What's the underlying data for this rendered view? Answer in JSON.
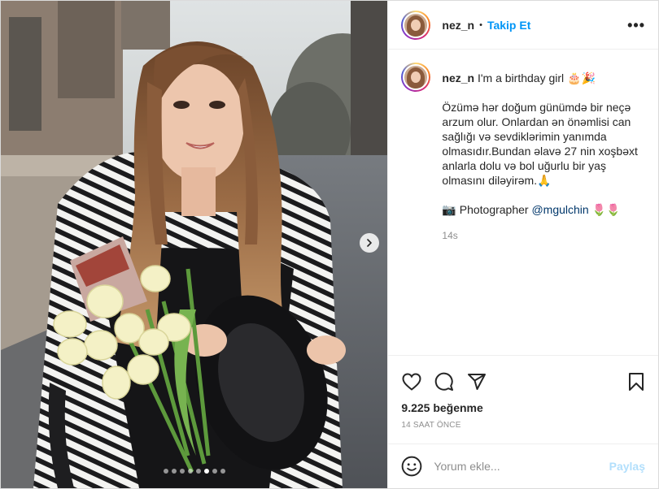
{
  "header": {
    "username": "nez_n",
    "separator": "•",
    "follow_label": "Takip Et",
    "more_label": "•••"
  },
  "caption": {
    "username": "nez_n",
    "title": "I'm a birthday girl 🎂🎉",
    "paragraph": "Özümə hər doğum günümdə bir neçə arzum olur. Onlardan ən önəmlisi can sağlığı və sevdiklərimin yanımda olmasıdır.Bundan əlavə 27 nin xoşbəxt anlarla dolu və bol uğurlu bir yaş olmasını diləyirəm.🙏",
    "credit_prefix": "📷 Photographer ",
    "credit_mention": "@mgulchin",
    "credit_suffix": " 🌷🌷",
    "time_ago": "14s"
  },
  "actions": {
    "icons": [
      "heart-icon",
      "comment-icon",
      "share-icon",
      "bookmark-icon"
    ]
  },
  "likes": "9.225 beğenme",
  "posted_time": "14 SAAT ÖNCE",
  "comment": {
    "placeholder": "Yorum ekle...",
    "share_label": "Paylaş"
  },
  "carousel": {
    "total": 8,
    "active_index": 5
  },
  "colors": {
    "accent": "#0095f6",
    "share_disabled": "#b2dffc",
    "muted": "#8e8e8e"
  }
}
